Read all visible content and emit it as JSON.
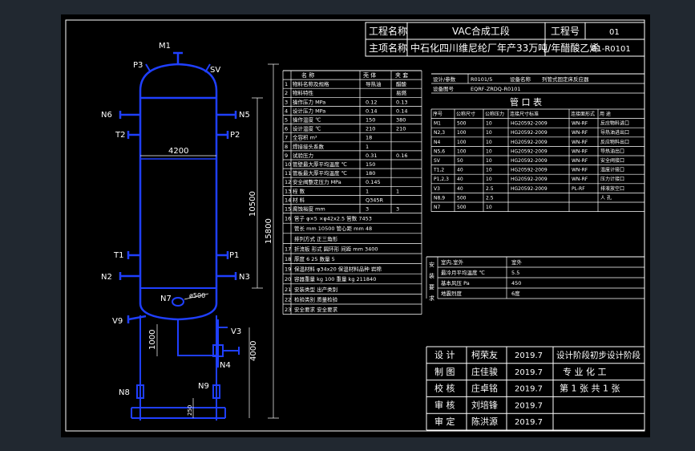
{
  "title_block": {
    "project_name_label": "工程名称",
    "project_name": "VAC合成工段",
    "project_no_label": "工程号",
    "project_no": "01",
    "item_name_label": "主项名称",
    "item_name": "中石化四川维尼纶厂年产33万吨/年醋酸乙烯",
    "item_no": "01-R0101"
  },
  "vessel": {
    "nozzle_labels": [
      "M1",
      "P3",
      "SV",
      "N6",
      "N5",
      "T2",
      "P2",
      "T1",
      "P1",
      "N2",
      "N3",
      "N7",
      "V9",
      "V3",
      "N4",
      "N8",
      "N9"
    ],
    "dimensions": [
      "4200",
      "10500",
      "15800",
      "1000",
      "4000",
      "ø500",
      "250"
    ]
  },
  "spec_table": {
    "headers": [
      "名 称",
      "壳 体",
      "夹 套"
    ],
    "rows": [
      [
        "1",
        "物料名称及规格",
        "导热油",
        "醋酸"
      ],
      [
        "2",
        "物料特性",
        "",
        "易燃"
      ],
      [
        "3",
        "操作压力 MPa",
        "0.12",
        "0.13"
      ],
      [
        "4",
        "设计压力 MPa",
        "0.14",
        "0.14"
      ],
      [
        "5",
        "操作温度 ℃",
        "150",
        "380"
      ],
      [
        "6",
        "设计温度 ℃",
        "210",
        "210"
      ],
      [
        "7",
        "全容积 m³",
        "18",
        ""
      ],
      [
        "8",
        "焊接接头系数",
        "1",
        ""
      ],
      [
        "9",
        "试验压力",
        "0.31",
        "0.16"
      ],
      [
        "10",
        "管壁最大厚平均温度 ℃",
        "150",
        ""
      ],
      [
        "11",
        "管板最大厚平均温度 ℃",
        "180",
        ""
      ],
      [
        "12",
        "安全阀整定压力 MPa",
        "0.145",
        ""
      ],
      [
        "13",
        "程 数",
        "1",
        "1"
      ],
      [
        "14",
        "材 料",
        "Q345R",
        ""
      ],
      [
        "15",
        "腐蚀裕度 mm",
        "3",
        "3"
      ]
    ],
    "tube_rows": [
      "管子 φ×5 ×φ42x2.5 管数 7453",
      "管长 mm 10500  管心距 mm 48",
      "排列方式 正三角形"
    ],
    "lower_rows": [
      "折流板  形式 圆环形  间距 mm 3400",
      "厚度 6  25  数量 5",
      "保温材料 φ34x20  保温材料品种 岩棉",
      "容器重量 kg 100  重量 kg 211840",
      "安装类型 出产类别",
      "检验类别 质量检验",
      "安全要求 安全要求"
    ],
    "nums_lower": [
      "16",
      "17",
      "18",
      "19",
      "20",
      "21",
      "22",
      "23"
    ]
  },
  "nozzle_table": {
    "header_left": [
      "设计/参数",
      "R0101/5"
    ],
    "header_right": [
      "设备名称",
      "列管式固定床反应器"
    ],
    "header_row2": [
      "设备图号",
      "EQRF-ZRDQ-R0101"
    ],
    "title": "管  口  表",
    "columns": [
      "序号",
      "公称尺寸",
      "公称压力",
      "连接尺寸标准",
      "连接面形式",
      "用 途"
    ],
    "rows": [
      [
        "M1",
        "500",
        "10",
        "HG20592-2009",
        "WN-RF",
        "反应物料进口"
      ],
      [
        "N2,3",
        "100",
        "10",
        "HG20592-2009",
        "WN-RF",
        "导热油进出口"
      ],
      [
        "N4",
        "100",
        "10",
        "HG20592-2009",
        "WN-RF",
        "反应物料出口"
      ],
      [
        "N5,6",
        "100",
        "10",
        "HG20592-2009",
        "WN-RF",
        "导热油出口"
      ],
      [
        "SV",
        "50",
        "10",
        "HG20592-2009",
        "WN-RF",
        "安全阀接口"
      ],
      [
        "T1,2",
        "40",
        "10",
        "HG20592-2009",
        "WN-RF",
        "温度计接口"
      ],
      [
        "P1,2,3",
        "40",
        "10",
        "HG20592-2009",
        "WN-RF",
        "压力计接口"
      ],
      [
        "V3",
        "40",
        "2.5",
        "HG20592-2009",
        "PL-RF",
        "排液放空口"
      ],
      [
        "N8,9",
        "500",
        "2.5",
        "",
        "",
        "人 孔"
      ],
      [
        "N7",
        "500",
        "10",
        "",
        "",
        ""
      ]
    ]
  },
  "design_data": {
    "side_label": "安 装 要 求",
    "rows": [
      [
        "室内,室外",
        "室外"
      ],
      [
        "最冷月平均温度 ℃",
        "5.5"
      ],
      [
        "基本风压 Pa",
        "450"
      ],
      [
        "地震烈度",
        "6度"
      ]
    ]
  },
  "signatures": {
    "rows": [
      [
        "设  计",
        "柯荣友",
        "2019.7"
      ],
      [
        "制  图",
        "庄佳骏",
        "2019.7"
      ],
      [
        "校  核",
        "庄卓铭",
        "2019.7"
      ],
      [
        "审  核",
        "刘培锋",
        "2019.7"
      ],
      [
        "审  定",
        "陈洪源",
        "2019.7"
      ]
    ],
    "stage_label": "设计阶段",
    "stage_value": "初步设计阶段",
    "major_label": "专  业",
    "major_value": "化  工",
    "sheet": "第 1 张  共 1 张"
  }
}
